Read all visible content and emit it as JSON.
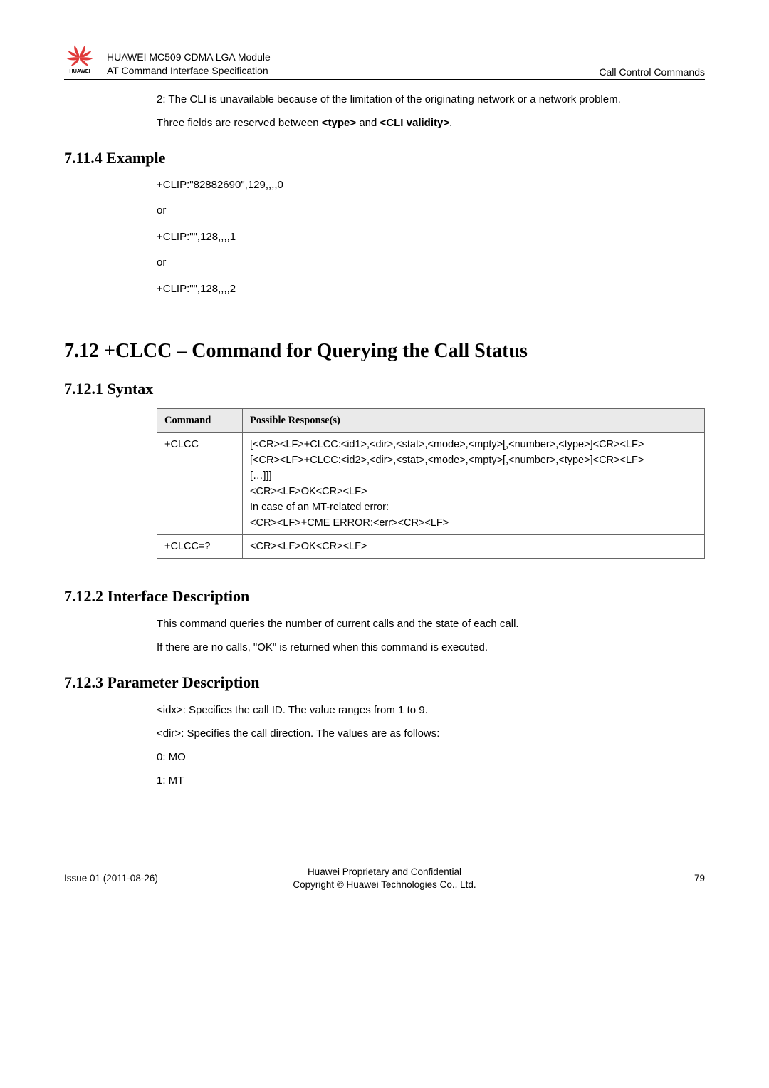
{
  "header": {
    "line1": "HUAWEI MC509 CDMA LGA Module",
    "line2": "AT Command Interface Specification",
    "right": "Call Control Commands"
  },
  "intro": {
    "p1": "2: The CLI is unavailable because of the limitation of the originating network or a network problem.",
    "p2_pre": "Three fields are reserved between ",
    "p2_b1": "<type>",
    "p2_mid": " and ",
    "p2_b2": "<CLI validity>",
    "p2_post": "."
  },
  "s7114": {
    "title": "7.11.4 Example",
    "l1": "+CLIP:\"82882690\",129,,,,0",
    "l2": "or",
    "l3": "+CLIP:\"\",128,,,,1",
    "l4": "or",
    "l5": "+CLIP:\"\",128,,,,2"
  },
  "s712": {
    "title": "7.12 +CLCC – Command for Querying the Call Status"
  },
  "s7121": {
    "title": "7.12.1 Syntax",
    "th1": "Command",
    "th2": "Possible Response(s)",
    "r1c1": "+CLCC",
    "r1l1": "[<CR><LF>+CLCC:<id1>,<dir>,<stat>,<mode>,<mpty>[,<number>,<type>]<CR><LF>",
    "r1l2": "[<CR><LF>+CLCC:<id2>,<dir>,<stat>,<mode>,<mpty>[,<number>,<type>]<CR><LF>",
    "r1l3": "[…]]]",
    "r1l4": "<CR><LF>OK<CR><LF>",
    "r1l5": "In case of an MT-related error:",
    "r1l6": "<CR><LF>+CME ERROR:<err><CR><LF>",
    "r2c1": "+CLCC=?",
    "r2c2": "<CR><LF>OK<CR><LF>"
  },
  "s7122": {
    "title": "7.12.2 Interface Description",
    "p1": "This command queries the number of current calls and the state of each call.",
    "p2": "If there are no calls, \"OK\" is returned when this command is executed."
  },
  "s7123": {
    "title": "7.12.3 Parameter Description",
    "p1": "<idx>: Specifies the call ID. The value ranges from 1 to 9.",
    "p2": "<dir>: Specifies the call direction. The values are as follows:",
    "p3": "0: MO",
    "p4": "1: MT"
  },
  "footer": {
    "left": "Issue 01 (2011-08-26)",
    "c1": "Huawei Proprietary and Confidential",
    "c2": "Copyright © Huawei Technologies Co., Ltd.",
    "right": "79"
  }
}
